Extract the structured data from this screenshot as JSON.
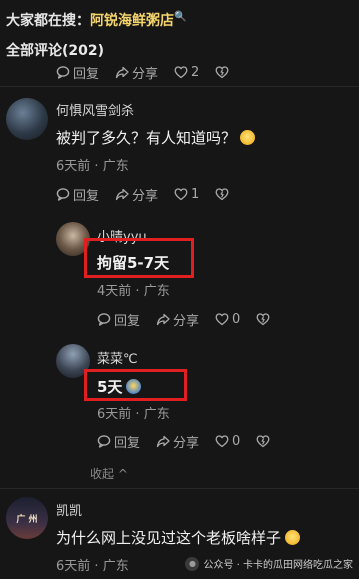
{
  "header": {
    "prefix": "大家都在搜：",
    "keyword": "阿锐海鲜粥店",
    "search_mark": "🔍"
  },
  "comment_count_label": "全部评论(202)",
  "top_actions": {
    "reply": "回复",
    "share": "分享",
    "like_count": "2"
  },
  "comments": [
    {
      "username": "何惧风雪剑杀",
      "content": "被判了多久？有人知道吗？",
      "emoji": "anxious-sweat-emoji",
      "time": "6天前",
      "location": "广东",
      "reply": "回复",
      "share": "分享",
      "like_count": "1",
      "replies": [
        {
          "username": "小晴yyu",
          "content": "拘留5-7天",
          "time": "4天前",
          "location": "广东",
          "reply": "回复",
          "share": "分享",
          "like_count": "0"
        },
        {
          "username": "菜菜℃",
          "content": "5天",
          "emoji": "smirk-emoji",
          "time": "6天前",
          "location": "广东",
          "reply": "回复",
          "share": "分享",
          "like_count": "0"
        }
      ],
      "collapse_label": "收起"
    },
    {
      "username": "凯凯",
      "avatar_text": "广 州",
      "content": "为什么网上没见过这个老板啥样子",
      "emoji": "laughing-tears-emoji",
      "time": "6天前",
      "location": "广东"
    }
  ],
  "watermark": "公众号 · 卡卡的瓜田网络吃瓜之家",
  "colors": {
    "background": "#161616",
    "keyword": "#f3d36b",
    "highlight_box": "#e02020",
    "secondary_text": "#9a9a9a"
  }
}
